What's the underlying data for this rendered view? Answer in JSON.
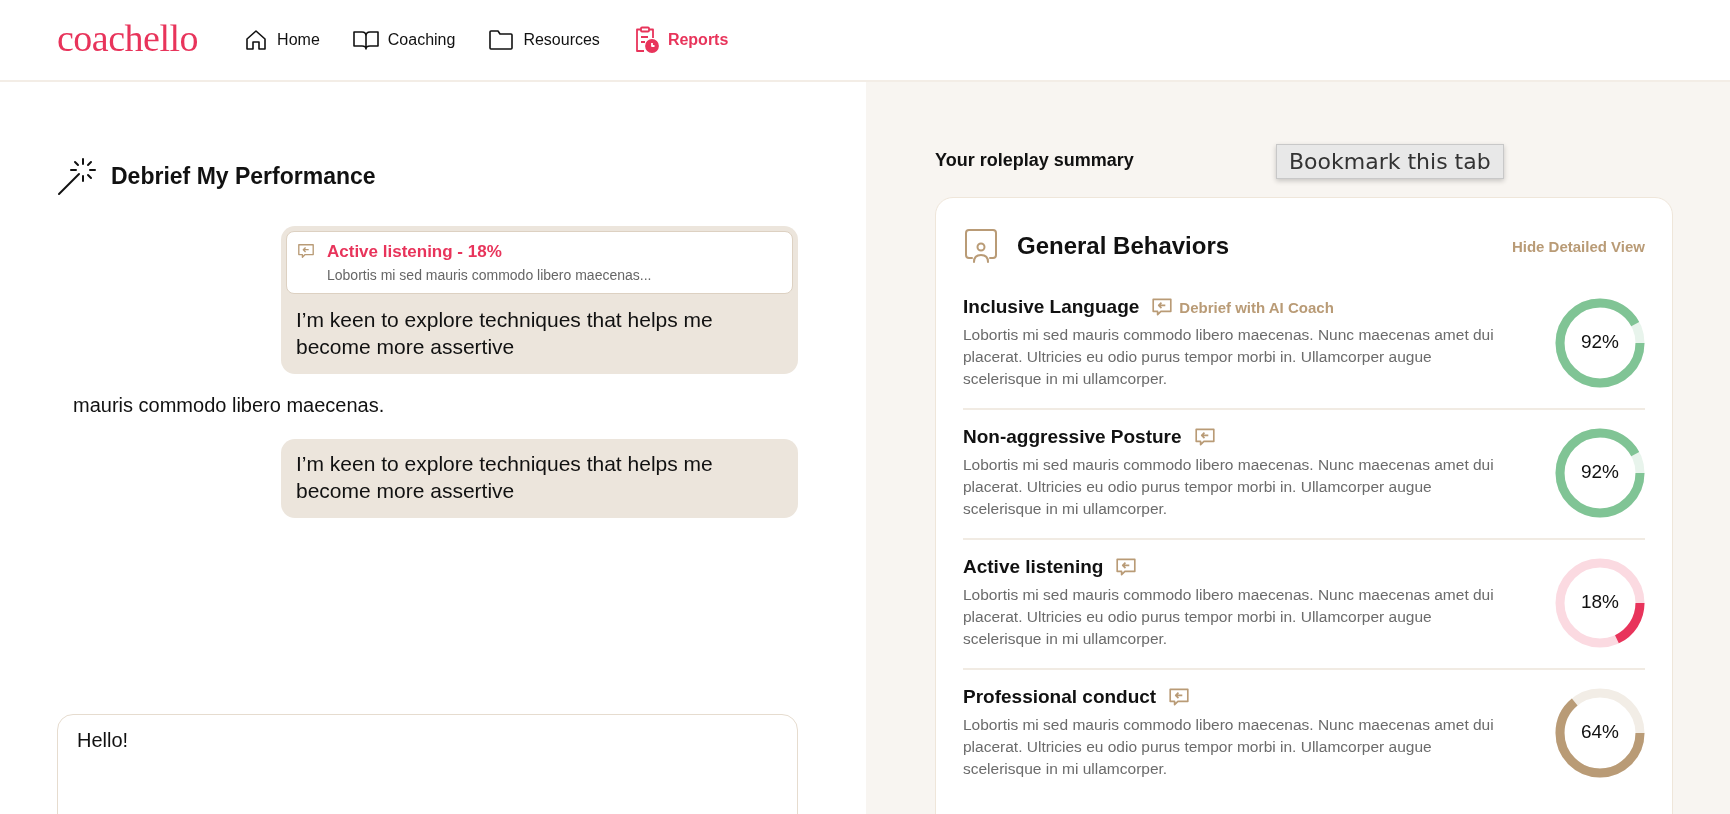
{
  "header": {
    "logo": "coachello",
    "nav": [
      {
        "label": "Home",
        "selected": false
      },
      {
        "label": "Coaching",
        "selected": false
      },
      {
        "label": "Resources",
        "selected": false
      },
      {
        "label": "Reports",
        "selected": true
      }
    ]
  },
  "debrief": {
    "title": "Debrief My Performance",
    "messages": [
      {
        "kind": "user",
        "quote": {
          "title": "Active listening - 18%",
          "text": "Lobortis mi sed mauris commodo libero maecenas..."
        },
        "text": "I’m keen to explore techniques that helps me become more assertive"
      },
      {
        "kind": "coach",
        "text": "mauris commodo libero maecenas."
      },
      {
        "kind": "user",
        "text": "I’m keen to explore techniques that helps me become more assertive"
      }
    ],
    "input": {
      "value": "Hello!"
    }
  },
  "summary": {
    "title": "Your roleplay summary",
    "tooltip": "Bookmark this tab",
    "card": {
      "title": "General Behaviors",
      "toggle": "Hide Detailed View",
      "items": [
        {
          "name": "Inclusive Language",
          "debrief_label": "Debrief with AI Coach",
          "description": "Lobortis mi sed mauris commodo libero maecenas. Nunc maecenas amet dui placerat. Ultricies eu odio purus tempor morbi in. Ullamcorper augue scelerisque in mi ullamcorper.",
          "level": 0.92,
          "reading": "92%",
          "color": "#80c495"
        },
        {
          "name": "Non-aggressive Posture",
          "description": "Lobortis mi sed mauris commodo libero maecenas. Nunc maecenas amet dui placerat. Ultricies eu odio purus tempor morbi in. Ullamcorper augue scelerisque in mi ullamcorper.",
          "level": 0.92,
          "reading": "92%",
          "color": "#80c495"
        },
        {
          "name": "Active listening",
          "description": "Lobortis mi sed mauris commodo libero maecenas. Nunc maecenas amet dui placerat. Ultricies eu odio purus tempor morbi in. Ullamcorper augue scelerisque in mi ullamcorper.",
          "level": 0.18,
          "reading": "18%",
          "color": "#e8345b"
        },
        {
          "name": "Professional conduct",
          "description": "Lobortis mi sed mauris commodo libero maecenas. Nunc maecenas amet dui placerat. Ultricies eu odio purus tempor morbi in. Ullamcorper augue scelerisque in mi ullamcorper.",
          "level": 0.64,
          "reading": "64%",
          "color": "#b99b76"
        }
      ]
    }
  }
}
